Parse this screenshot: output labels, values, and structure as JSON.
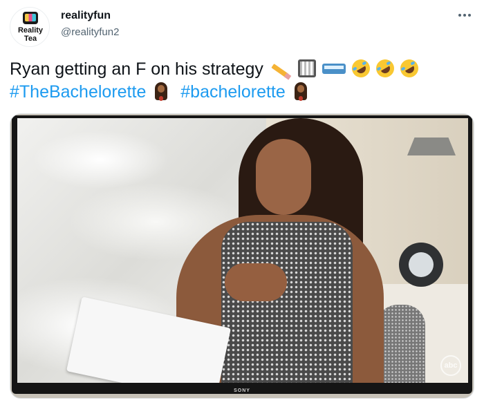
{
  "author": {
    "display_name": "realityfun",
    "handle": "@realityfun2",
    "avatar": {
      "line1": "Reality",
      "line2": "Tea",
      "icon": "tv-icon"
    }
  },
  "more_icon": "more-icon",
  "tweet": {
    "text_line1": "Ryan getting an F on his strategy",
    "emojis_line1": [
      "pencil-icon",
      "abacus-icon",
      "bus-icon",
      "rofl-icon",
      "rofl-icon",
      "rofl-icon"
    ],
    "hashtag1": "#TheBachelorette",
    "hashtag2": "#bachelorette",
    "emoji_line2": "woman-icon"
  },
  "media": {
    "tv_brand": "SONY",
    "network_logo": "abc"
  },
  "colors": {
    "hashtag": "#1d9bf0",
    "handle": "#536471",
    "text": "#0f1419"
  }
}
